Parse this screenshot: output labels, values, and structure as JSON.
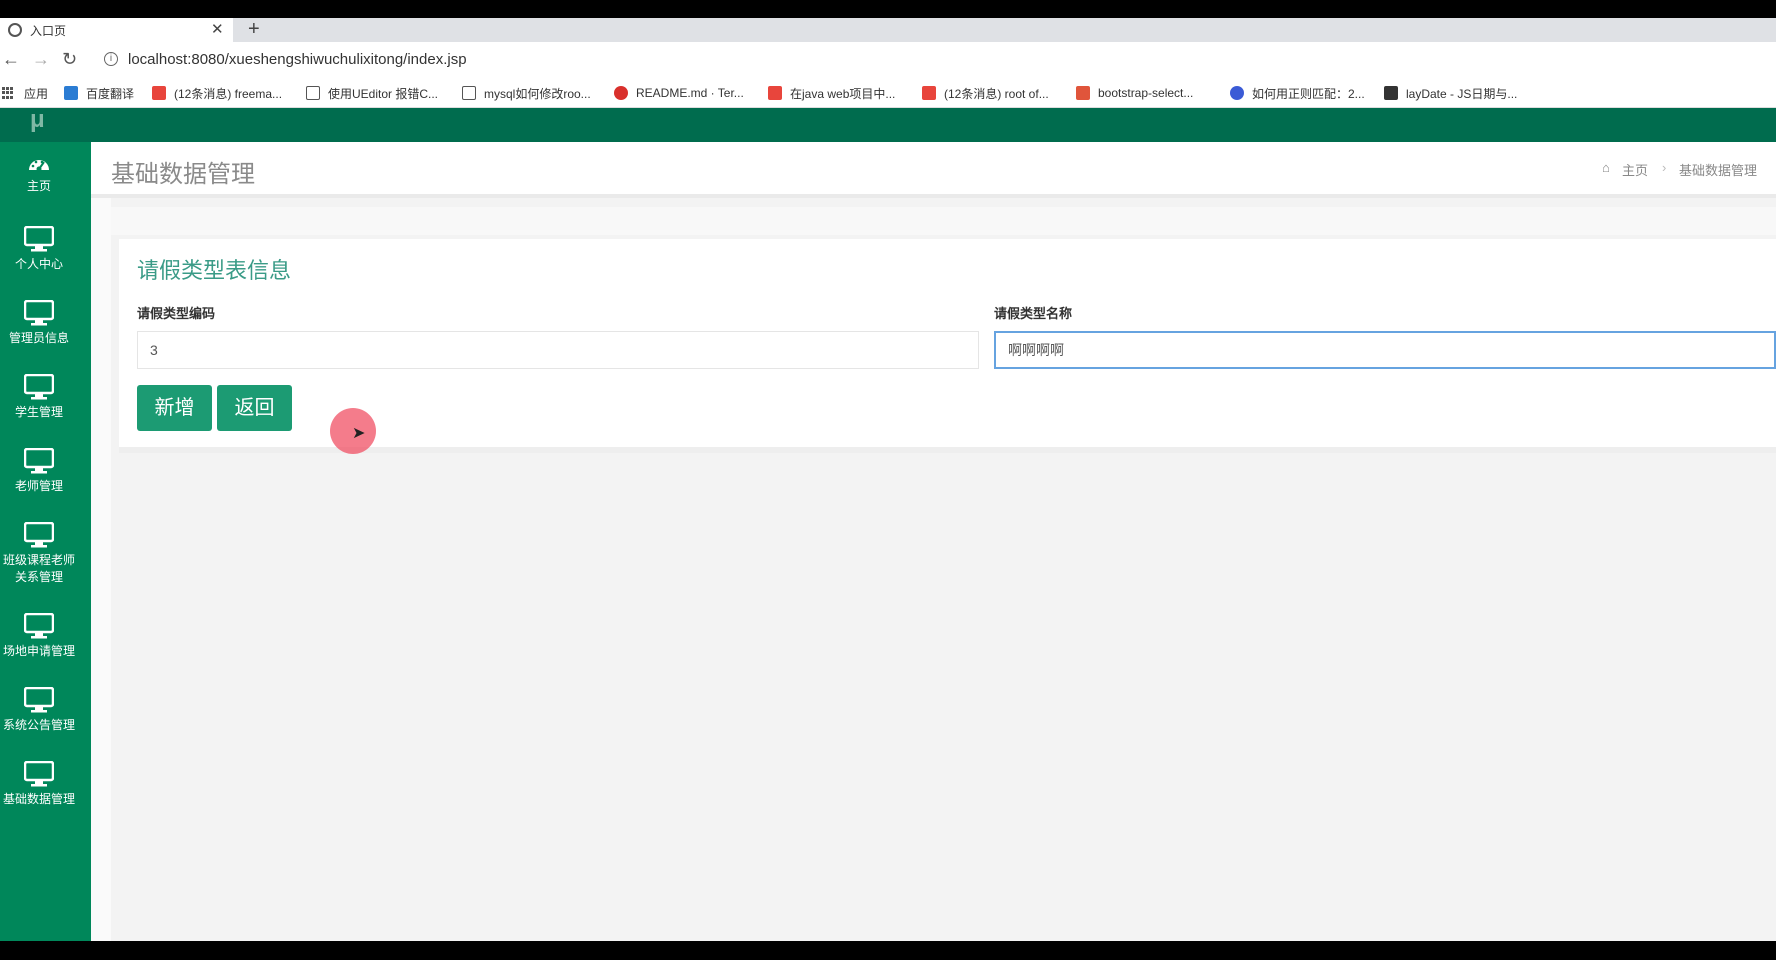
{
  "browser": {
    "tab_title": "入口页",
    "url": "localhost:8080/xueshengshiwuchulixitong/index.jsp",
    "bookmarks": [
      {
        "label": "应用",
        "color": "#555555"
      },
      {
        "label": "百度翻译",
        "color": "#2b7cd3"
      },
      {
        "label": "(12条消息) freema...",
        "color": "#e8453c"
      },
      {
        "label": "使用UEditor 报错C...",
        "color": "#555555"
      },
      {
        "label": "mysql如何修改roo...",
        "color": "#555555"
      },
      {
        "label": "README.md · Ter...",
        "color": "#d9302c"
      },
      {
        "label": "在java web项目中...",
        "color": "#e8453c"
      },
      {
        "label": "(12条消息) root of...",
        "color": "#e8453c"
      },
      {
        "label": "bootstrap-select...",
        "color": "#e0553b"
      },
      {
        "label": "如何用正则匹配：2...",
        "color": "#3b5bd6"
      },
      {
        "label": "layDate - JS日期与...",
        "color": "#333333"
      }
    ]
  },
  "app": {
    "logo": "μ",
    "sidebar": [
      {
        "label": "主页",
        "icon": "dashboard-icon"
      },
      {
        "label": "个人中心",
        "icon": "monitor-icon"
      },
      {
        "label": "管理员信息",
        "icon": "monitor-icon"
      },
      {
        "label": "学生管理",
        "icon": "monitor-icon"
      },
      {
        "label": "老师管理",
        "icon": "monitor-icon"
      },
      {
        "label": "班级课程老师关系管理",
        "line1": "班级课程老师",
        "line2": "关系管理",
        "icon": "monitor-icon"
      },
      {
        "label": "场地申请管理",
        "icon": "monitor-icon"
      },
      {
        "label": "系统公告管理",
        "icon": "monitor-icon"
      },
      {
        "label": "基础数据管理",
        "icon": "monitor-icon"
      }
    ],
    "page_title": "基础数据管理",
    "breadcrumb": {
      "home": "主页",
      "sep": "›",
      "current": "基础数据管理"
    },
    "form": {
      "title": "请假类型表信息",
      "code_label": "请假类型编码",
      "code_value": "3",
      "name_label": "请假类型名称",
      "name_value": "啊啊啊啊",
      "add_button": "新增",
      "back_button": "返回"
    }
  },
  "colors": {
    "topbar": "#006c4e",
    "sidebar": "#00875a",
    "button": "#1c9b73",
    "title_accent": "#3a9b87"
  }
}
